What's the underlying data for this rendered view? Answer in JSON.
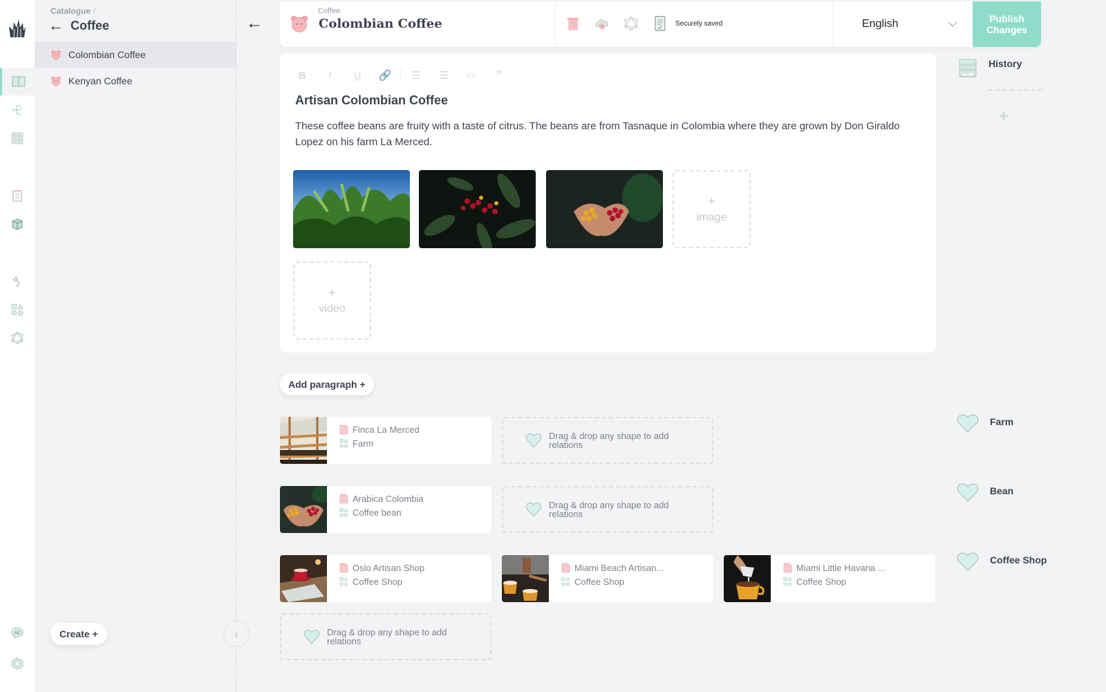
{
  "rail": {
    "items": [
      {
        "icon": "catalogue-book-icon",
        "active": true
      },
      {
        "icon": "hierarchy-tree-icon",
        "active": false
      },
      {
        "icon": "grid-icon",
        "active": false
      },
      {
        "icon": "clipboard-icon",
        "active": false
      },
      {
        "icon": "box-icon",
        "active": false
      },
      {
        "icon": "hook-icon",
        "active": false
      },
      {
        "icon": "shapes-icon",
        "active": false
      },
      {
        "icon": "graphql-icon",
        "active": false
      },
      {
        "icon": "language-az-icon",
        "active": false
      },
      {
        "icon": "settings-gear-icon",
        "active": false
      }
    ]
  },
  "sidebar": {
    "breadcrumb": "Catalogue",
    "breadcrumb_sep": "/",
    "title": "Coffee",
    "items": [
      {
        "label": "Colombian Coffee",
        "selected": true
      },
      {
        "label": "Kenyan Coffee",
        "selected": false
      }
    ],
    "create_label": "Create +"
  },
  "header": {
    "breadcrumb": "Coffee",
    "title": "Colombian Coffee",
    "save_status": "Securely saved",
    "language": "English",
    "publish_label": "Publish Changes"
  },
  "editor": {
    "toolbar": [
      "B",
      "I",
      "U",
      "link",
      "bulleted-list",
      "numbered-list",
      "code",
      "quote"
    ],
    "title": "Artisan Colombian Coffee",
    "body": "These coffee beans are fruity with a taste of citrus. The beans are from Tasnaque in Colombia where they are grown by Don Giraldo Lopez on his farm La Merced.",
    "images": [
      "banana-plants-photo",
      "coffee-cherries-photo",
      "hands-holding-beans-photo"
    ],
    "add_image_label": "image",
    "add_video_label": "video",
    "add_plus": "+"
  },
  "add_paragraph_label": "Add paragraph +",
  "history": {
    "label": "History"
  },
  "relations": {
    "drop_hint": "Drag & drop any shape to add relations",
    "groups": [
      {
        "label": "Farm",
        "items": [
          {
            "name": "Finca La Merced",
            "shape": "Farm",
            "photo": "drying-beds-photo"
          }
        ]
      },
      {
        "label": "Bean",
        "items": [
          {
            "name": "Arabica Colombia",
            "shape": "Coffee bean",
            "photo": "hands-holding-beans-photo"
          }
        ]
      },
      {
        "label": "Coffee Shop",
        "items": [
          {
            "name": "Oslo Artisan Shop",
            "shape": "Coffee Shop",
            "photo": "red-cup-photo"
          },
          {
            "name": "Miami Beach Artisan...",
            "shape": "Coffee Shop",
            "photo": "espresso-machine-photo"
          },
          {
            "name": "Miami Little Havana ...",
            "shape": "Coffee Shop",
            "photo": "latte-pour-photo"
          }
        ]
      }
    ]
  },
  "colors": {
    "accent": "#90dcca",
    "background": "#f2f3f5",
    "text": "#3d4250",
    "danger_pink": "#f8c9cc"
  }
}
